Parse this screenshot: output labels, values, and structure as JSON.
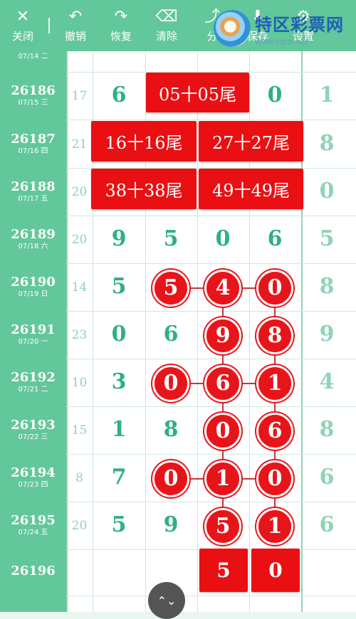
{
  "toolbar": {
    "items": [
      {
        "label": "关闭",
        "icon": "close-icon",
        "glyph": "✕"
      },
      {
        "label": "撤销",
        "icon": "undo-icon",
        "glyph": "↶"
      },
      {
        "label": "恢复",
        "icon": "redo-icon",
        "glyph": "↷"
      },
      {
        "label": "清除",
        "icon": "trash-icon",
        "glyph": "⌫"
      },
      {
        "label": "分",
        "icon": "share-icon",
        "glyph": "⤴"
      },
      {
        "label": "保存",
        "icon": "save-icon",
        "glyph": "⬇"
      },
      {
        "label": "设置",
        "icon": "settings-icon",
        "glyph": "⚙"
      }
    ]
  },
  "watermark": {
    "title": "特区彩票网",
    "url": "www.tqcp.net"
  },
  "rows": [
    {
      "issue": "",
      "date": "07/14 二",
      "count": "",
      "cells": [
        "",
        "",
        "",
        "",
        ""
      ]
    },
    {
      "issue": "26186",
      "date": "07/15 三",
      "count": "17",
      "cells": [
        "6",
        "",
        "",
        "0",
        "1"
      ]
    },
    {
      "issue": "26187",
      "date": "07/16 四",
      "count": "21",
      "cells": [
        "",
        "",
        "",
        "",
        "8"
      ]
    },
    {
      "issue": "26188",
      "date": "07/17 五",
      "count": "20",
      "cells": [
        "",
        "",
        "",
        "",
        "0"
      ]
    },
    {
      "issue": "26189",
      "date": "07/18 六",
      "count": "20",
      "cells": [
        "9",
        "5",
        "0",
        "6",
        "5"
      ]
    },
    {
      "issue": "26190",
      "date": "07/19 日",
      "count": "14",
      "cells": [
        "5",
        "5",
        "4",
        "0",
        "8"
      ]
    },
    {
      "issue": "26191",
      "date": "07/20 一",
      "count": "23",
      "cells": [
        "0",
        "6",
        "9",
        "8",
        "9"
      ]
    },
    {
      "issue": "26192",
      "date": "07/21 二",
      "count": "10",
      "cells": [
        "3",
        "0",
        "6",
        "1",
        "4"
      ]
    },
    {
      "issue": "26193",
      "date": "07/22 三",
      "count": "15",
      "cells": [
        "1",
        "8",
        "0",
        "6",
        "8"
      ]
    },
    {
      "issue": "26194",
      "date": "07/23 四",
      "count": "8",
      "cells": [
        "7",
        "0",
        "1",
        "0",
        "6"
      ]
    },
    {
      "issue": "26195",
      "date": "07/24 五",
      "count": "20",
      "cells": [
        "5",
        "9",
        "5",
        "1",
        "6"
      ]
    },
    {
      "issue": "26196",
      "date": "",
      "count": "",
      "cells": [
        "",
        "",
        "5",
        "0",
        ""
      ]
    }
  ],
  "banners": [
    {
      "text": "05十05尾"
    },
    {
      "text": "16十16尾"
    },
    {
      "text": "27十27尾"
    },
    {
      "text": "38十38尾"
    },
    {
      "text": "49十49尾"
    }
  ],
  "balls": [
    {
      "value": "5"
    },
    {
      "value": "4"
    },
    {
      "value": "0"
    },
    {
      "value": "9"
    },
    {
      "value": "8"
    },
    {
      "value": "0"
    },
    {
      "value": "6"
    },
    {
      "value": "1"
    },
    {
      "value": "0"
    },
    {
      "value": "6"
    },
    {
      "value": "0"
    },
    {
      "value": "1"
    },
    {
      "value": "0"
    },
    {
      "value": "5"
    },
    {
      "value": "1"
    }
  ],
  "bottom_boxes": [
    {
      "value": "5"
    },
    {
      "value": "0"
    }
  ],
  "float_button": {
    "glyph": "⌃⌄"
  },
  "colors": {
    "header": "#62c79a",
    "red": "#ea0f12",
    "digit": "#2fb085"
  }
}
